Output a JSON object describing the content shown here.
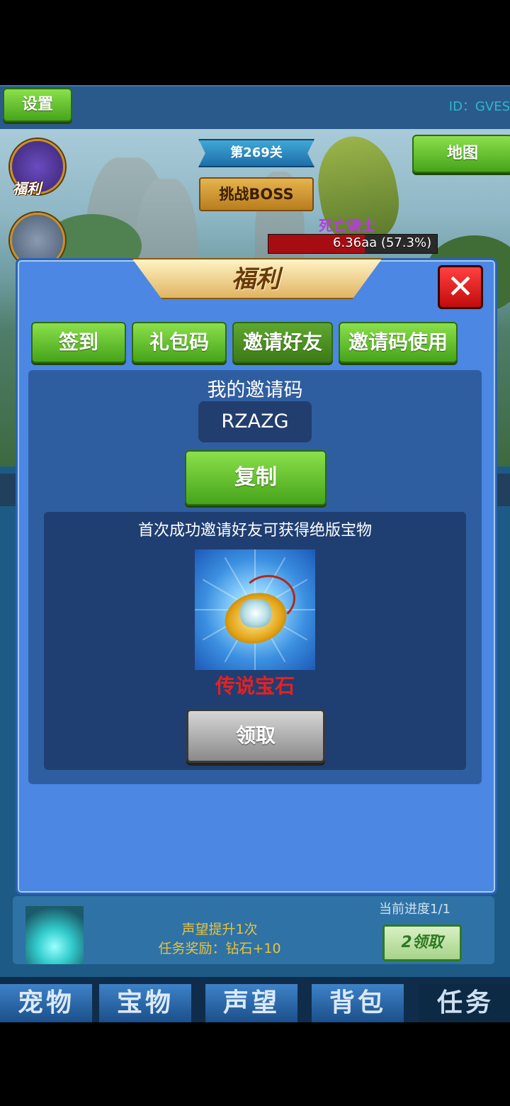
{
  "topbar": {
    "settings_label": "设置",
    "player_id": "ID：GVES"
  },
  "scene": {
    "level_label": "第269关",
    "boss_button_label": "挑战BOSS",
    "map_button_label": "地图",
    "boss_name": "死亡骑士",
    "boss_hp_text": "6.36aa (57.3%)",
    "boss_hp_fraction": 0.573,
    "side_menu_label": "福利"
  },
  "dialog": {
    "title": "福利",
    "close_icon": "close-icon",
    "tabs": [
      {
        "label": "签到"
      },
      {
        "label": "礼包码"
      },
      {
        "label": "邀请好友"
      },
      {
        "label": "邀请码使用"
      }
    ],
    "my_code_label": "我的邀请码",
    "invite_code": "RZAZG",
    "copy_label": "复制",
    "reward_desc": "首次成功邀请好友可获得绝版宝物",
    "reward_icon": "gem-amulet-icon",
    "reward_name": "传说宝石",
    "claim_label": "领取"
  },
  "task": {
    "progress": "当前进度1/1",
    "title": "声望提升1次",
    "reward": "任务奖励：钻石+10",
    "claim_label": "2领取"
  },
  "bottom_nav": {
    "tabs": [
      {
        "label": "宠物"
      },
      {
        "label": "宝物"
      },
      {
        "label": "声望"
      },
      {
        "label": "背包"
      },
      {
        "label": "任务"
      }
    ]
  },
  "colors": {
    "dialog_bg": "#4b87e3",
    "accent_green": "#46a41a",
    "reward_name": "#e82020"
  }
}
